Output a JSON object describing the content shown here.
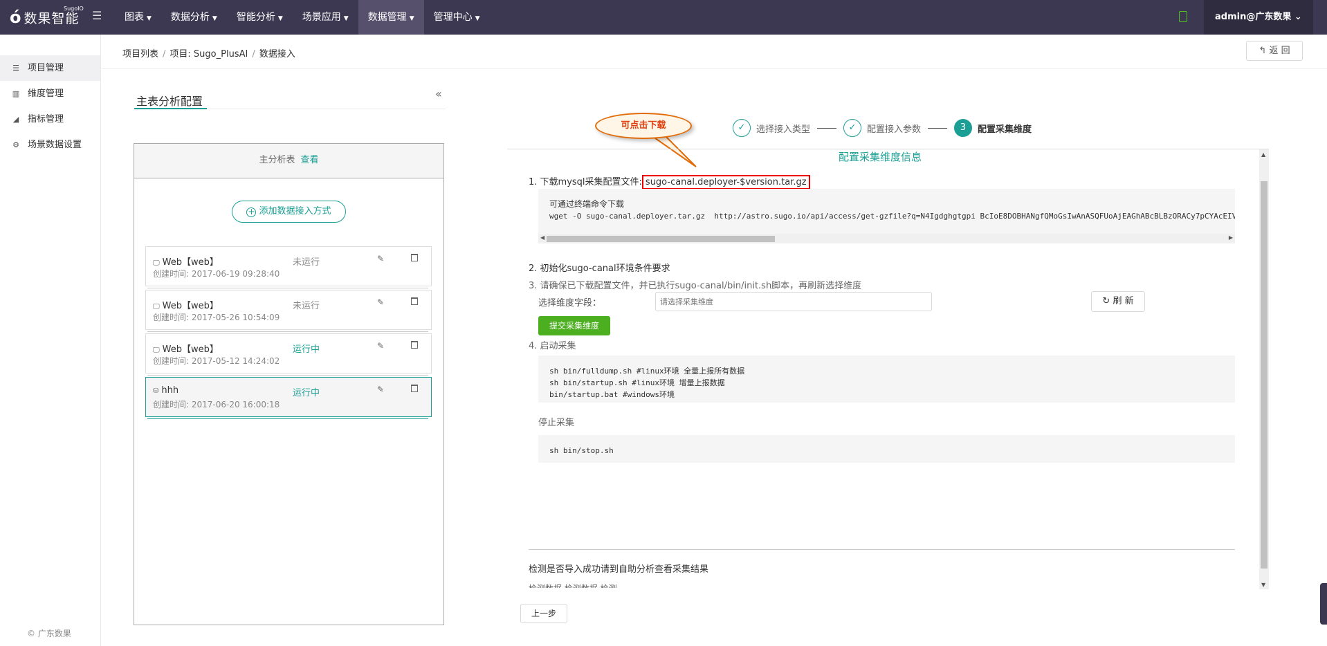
{
  "app": {
    "logo_text": "数果智能",
    "logo_sup": "SugoIO",
    "user": "admin@广东数果 ⌄"
  },
  "nav": [
    {
      "label": "图表"
    },
    {
      "label": "数据分析"
    },
    {
      "label": "智能分析"
    },
    {
      "label": "场景应用"
    },
    {
      "label": "数据管理"
    },
    {
      "label": "管理中心"
    }
  ],
  "sidebar": {
    "items": [
      {
        "label": "项目管理",
        "icon": "list-icon"
      },
      {
        "label": "维度管理",
        "icon": "bar-chart-icon"
      },
      {
        "label": "指标管理",
        "icon": "area-chart-icon"
      },
      {
        "label": "场景数据设置",
        "icon": "settings-icon"
      }
    ],
    "copyright": "© 广东数果"
  },
  "breadcrumb": {
    "items": [
      "项目列表",
      "项目: Sugo_PlusAI",
      "数据接入"
    ],
    "back_label": "返 回"
  },
  "panel": {
    "title": "主表分析配置",
    "head_text": "主分析表",
    "head_link": "查看",
    "add_label": "添加数据接入方式",
    "cards": [
      {
        "title": "Web【web】",
        "time": "创建时间: 2017-06-19 09:28:40",
        "status": "未运行",
        "running": false,
        "device": "desktop-icon"
      },
      {
        "title": "Web【web】",
        "time": "创建时间: 2017-05-26 10:54:09",
        "status": "未运行",
        "running": false,
        "device": "desktop-icon"
      },
      {
        "title": "Web【web】",
        "time": "创建时间: 2017-05-12 14:24:02",
        "status": "运行中",
        "running": true,
        "device": "desktop-icon"
      },
      {
        "title": "hhh",
        "time": "创建时间: 2017-06-20 16:00:18",
        "status": "运行中",
        "running": true,
        "device": "database-icon"
      }
    ]
  },
  "steps": [
    {
      "label": "选择接入类型",
      "state": "done"
    },
    {
      "label": "配置接入参数",
      "state": "done"
    },
    {
      "label": "配置采集维度",
      "state": "current",
      "number": "3"
    }
  ],
  "callout": "可点击下载",
  "content": {
    "title": "配置采集维度信息",
    "step1_prefix": "1. 下载mysql采集配置文件:",
    "step1_file": "sugo-canal.deployer-$version.tar.gz",
    "code1_title": "可通过终端命令下载",
    "code1_cmd": "wget -O sugo-canal.deployer.tar.gz  http://astro.sugo.io/api/access/get-gzfile?q=N4Igdghgtgpi BcIoE8DOBHANgfQMoGsIwAnASQFUoAjEAGhABcBLBzORACy7pCYAcEIVMa",
    "step2": "2. 初始化sugo-canal环境条件要求",
    "step3": "3. 请确保已下载配置文件，并已执行sugo-canal/bin/init.sh脚本，再刷新选择维度",
    "field_label": "选择维度字段：",
    "field_placeholder": "请选择采集维度",
    "refresh_label": "刷 新",
    "submit_label": "提交采集维度",
    "step4": "4. 启动采集",
    "code2": "sh bin/fulldump.sh #linux环境 全量上报所有数据\nsh bin/startup.sh #linux环境 增量上报数据\nbin/startup.bat #windows环境",
    "stop_label": "停止采集",
    "code3": "sh bin/stop.sh",
    "check_text": "检测是否导入成功请到自助分析查看采集结果",
    "cut_text": "检测数据·检测数据·检测"
  },
  "prev_label": "上一步",
  "colors": {
    "accent": "#1b9f95",
    "nav_bg": "#3c3852",
    "submit": "#4caf20",
    "highlight": "#e00000",
    "callout": "#e36c09"
  }
}
